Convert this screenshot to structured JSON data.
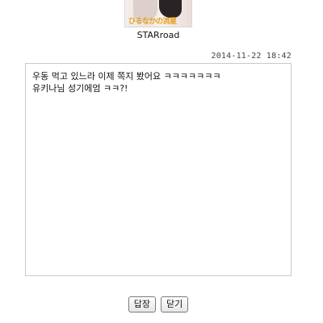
{
  "sender": {
    "avatar_caption": "ひるなかの流星",
    "username": "STARroad"
  },
  "message": {
    "timestamp": "2014-11-22 18:42",
    "body": "우동 먹고 있느라 이제 쪽지 봤어요 ㅋㅋㅋㅋㅋㅋㅋ\n유키나님 성기에엄 ㅋㅋ?!"
  },
  "actions": {
    "reply_label": "답장",
    "close_label": "닫기"
  }
}
